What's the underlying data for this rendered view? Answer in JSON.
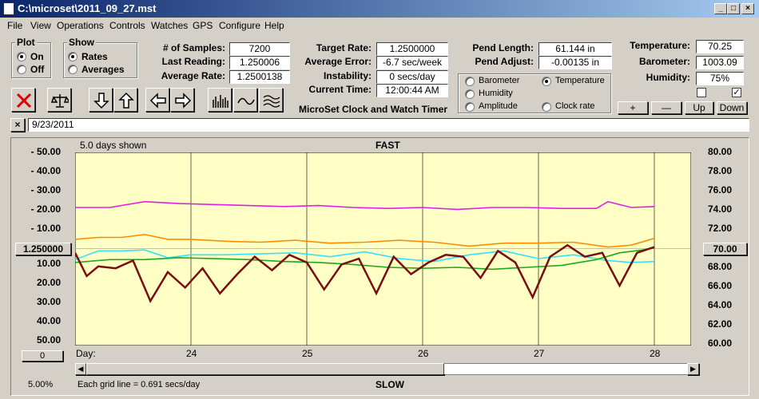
{
  "window": {
    "title": "C:\\microset\\2011_09_27.mst"
  },
  "menu": [
    "File",
    "View",
    "Operations",
    "Controls",
    "Watches",
    "GPS",
    "Configure",
    "Help"
  ],
  "plot_group": {
    "title": "Plot",
    "on": "On",
    "off": "Off",
    "selected": "On"
  },
  "show_group": {
    "title": "Show",
    "rates": "Rates",
    "averages": "Averages",
    "selected": "Rates"
  },
  "stats": {
    "samples_label": "# of Samples:",
    "samples": "7200",
    "last_reading_label": "Last Reading:",
    "last_reading": "1.250006",
    "average_rate_label": "Average Rate:",
    "average_rate": "1.2500138"
  },
  "rates": {
    "target_rate_label": "Target Rate:",
    "target_rate": "1.2500000",
    "average_error_label": "Average Error:",
    "average_error": "-6.7 sec/week",
    "instability_label": "Instability:",
    "instability": "0 secs/day",
    "current_time_label": "Current Time:",
    "current_time": "12:00:44 AM",
    "app_name": "MicroSet Clock and Watch Timer"
  },
  "pendulum": {
    "length_label": "Pend Length:",
    "length": "61.144 in",
    "adjust_label": "Pend Adjust:",
    "adjust": "-0.00135 in"
  },
  "series_select": {
    "barometer": "Barometer",
    "temperature": "Temperature",
    "humidity": "Humidity",
    "amplitude": "Amplitude",
    "clock_rate": "Clock rate",
    "selected": "Temperature"
  },
  "environment": {
    "temperature_label": "Temperature:",
    "temperature": "70.25",
    "barometer_label": "Barometer:",
    "barometer": "1003.09",
    "humidity_label": "Humidity:",
    "humidity": "75%"
  },
  "scale_buttons": {
    "plus": "+",
    "minus": "—",
    "up": "Up",
    "down": "Down"
  },
  "note": {
    "close": "×",
    "value": "9/23/2011"
  },
  "chart_header": {
    "days_shown": "5.0 days shown",
    "fast": "FAST",
    "slow": "SLOW",
    "grid_note": "Each grid line = 0.691 secs/day",
    "zoom": "5.00%",
    "offset": "0"
  },
  "chart_left_value": "1.250000",
  "chart_right_value": "70.00",
  "colors": {
    "plot_bg": "#ffffc6",
    "barometer": "#ff8c00",
    "temperature": "#1fa81f",
    "humidity": "#e020e0",
    "amplitude": "#33e0ff",
    "clock_rate": "#7a0d0d"
  },
  "chart_data": {
    "type": "line",
    "x_label": "Day:",
    "x_ticks": [
      "24",
      "25",
      "26",
      "27",
      "28"
    ],
    "y_left_ticks": [
      "50.00",
      "40.00",
      "30.00",
      "20.00",
      "10.00",
      "10.00",
      "20.00",
      "30.00",
      "40.00",
      "50.00"
    ],
    "y_left_ticks_above": [
      "50.00",
      "40.00",
      "30.00",
      "20.00",
      "10.00"
    ],
    "y_left_ticks_below": [
      "10.00",
      "20.00",
      "30.00",
      "40.00",
      "50.00"
    ],
    "y_right_ticks": [
      "80.00",
      "78.00",
      "76.00",
      "74.00",
      "72.00",
      "70.00",
      "68.00",
      "66.00",
      "64.00",
      "62.00",
      "60.00"
    ],
    "y_right_ticks_upper": [
      "80.00",
      "78.00",
      "76.00",
      "74.00",
      "72.00"
    ],
    "y_right_ticks_lower": [
      "68.00",
      "66.00",
      "64.00",
      "62.00",
      "60.00"
    ],
    "x_range_days": [
      23.0,
      28.0
    ],
    "y_left_range": [
      -50,
      50
    ],
    "y_right_range": [
      60,
      80
    ],
    "series": [
      {
        "name": "Humidity",
        "color": "#e020e0",
        "days": [
          23.0,
          23.3,
          23.6,
          23.9,
          24.2,
          24.5,
          24.8,
          25.1,
          25.4,
          25.7,
          26.0,
          26.3,
          26.6,
          26.9,
          27.2,
          27.5,
          27.6,
          27.8,
          28.0
        ],
        "values": [
          74.3,
          74.3,
          74.9,
          74.7,
          74.6,
          74.5,
          74.4,
          74.5,
          74.3,
          74.2,
          74.3,
          74.1,
          74.3,
          74.3,
          74.2,
          74.2,
          74.9,
          74.3,
          74.4
        ]
      },
      {
        "name": "Barometer",
        "color": "#ff8c00",
        "days": [
          23.0,
          23.2,
          23.4,
          23.6,
          23.8,
          24.0,
          24.3,
          24.6,
          24.9,
          25.2,
          25.5,
          25.8,
          26.1,
          26.4,
          26.7,
          27.0,
          27.3,
          27.6,
          27.8,
          28.0
        ],
        "values": [
          71.0,
          71.2,
          71.2,
          71.5,
          71.0,
          71.0,
          70.8,
          70.7,
          70.9,
          70.6,
          70.7,
          70.9,
          70.7,
          70.3,
          70.6,
          70.6,
          70.7,
          70.2,
          70.4,
          71.1
        ]
      },
      {
        "name": "Amplitude",
        "color": "#33e0ff",
        "days": [
          23.0,
          23.2,
          23.4,
          23.6,
          23.8,
          24.0,
          24.3,
          24.6,
          24.9,
          25.2,
          25.5,
          25.8,
          26.1,
          26.4,
          26.7,
          27.0,
          27.3,
          27.6,
          27.8,
          28.0
        ],
        "values": [
          68.9,
          69.8,
          69.8,
          69.9,
          69.1,
          69.4,
          69.4,
          69.5,
          69.6,
          69.2,
          69.7,
          69.0,
          68.7,
          69.4,
          69.8,
          69.0,
          69.4,
          68.8,
          68.6,
          68.7
        ]
      },
      {
        "name": "Temperature",
        "color": "#1fa81f",
        "days": [
          23.0,
          23.3,
          23.6,
          23.9,
          24.2,
          24.5,
          24.8,
          25.1,
          25.4,
          25.7,
          26.0,
          26.3,
          26.6,
          26.9,
          27.2,
          27.5,
          27.7,
          27.9,
          28.0
        ],
        "values": [
          68.6,
          68.9,
          68.9,
          69.1,
          69.0,
          68.9,
          68.7,
          68.6,
          68.4,
          68.1,
          68.0,
          68.1,
          67.9,
          68.1,
          68.3,
          68.9,
          69.6,
          69.9,
          70.1
        ]
      },
      {
        "name": "Clock rate",
        "color": "#7a0d0d",
        "days": [
          23.0,
          23.1,
          23.2,
          23.35,
          23.5,
          23.65,
          23.8,
          23.95,
          24.1,
          24.25,
          24.4,
          24.55,
          24.7,
          24.85,
          25.0,
          25.15,
          25.3,
          25.45,
          25.6,
          25.75,
          25.9,
          26.05,
          26.2,
          26.35,
          26.5,
          26.65,
          26.8,
          26.95,
          27.1,
          27.25,
          27.4,
          27.55,
          27.7,
          27.85,
          28.0
        ],
        "values": [
          -2.0,
          -14.0,
          -9.0,
          -10.0,
          -6.0,
          -27.0,
          -12.0,
          -20.0,
          -10.0,
          -23.0,
          -13.0,
          -4.0,
          -11.0,
          -3.0,
          -7.0,
          -21.0,
          -8.0,
          -5.0,
          -23.0,
          -4.0,
          -13.0,
          -7.0,
          -3.0,
          -4.0,
          -15.0,
          -1.0,
          -7.0,
          -25.0,
          -4.0,
          2.0,
          -4.0,
          -2.0,
          -19.0,
          -2.0,
          1.0
        ]
      }
    ]
  },
  "scroll": {
    "left": "◀",
    "right": "▶"
  }
}
